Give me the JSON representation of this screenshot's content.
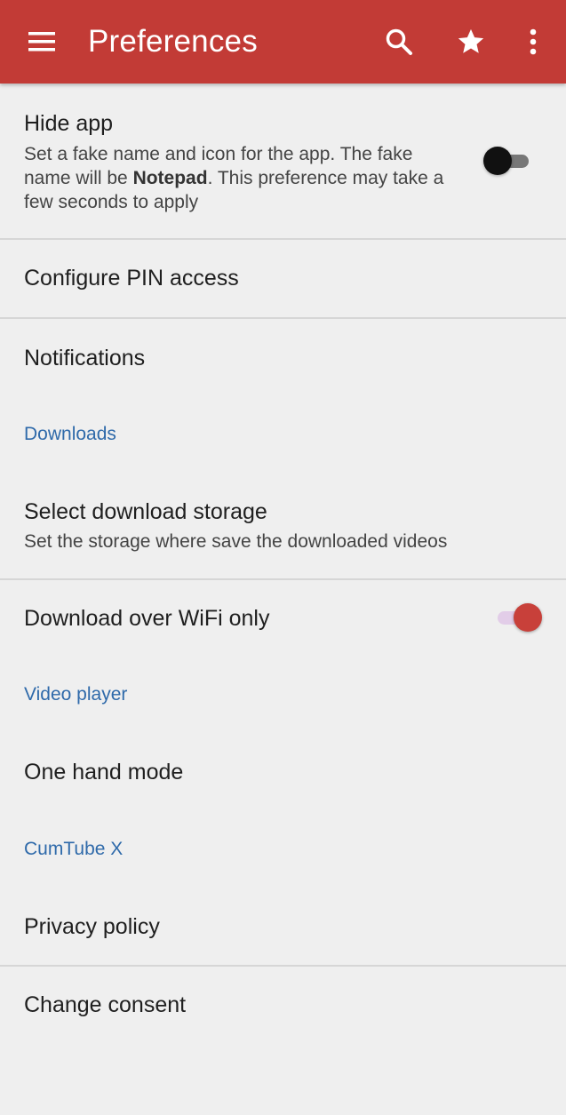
{
  "appbar": {
    "title": "Preferences",
    "menu_icon": "hamburger-menu-icon",
    "search_icon": "search-icon",
    "star_icon": "star-icon",
    "overflow_icon": "more-vert-icon",
    "color": "#c23b36"
  },
  "prefs": {
    "hide_app": {
      "title": "Hide app",
      "summary_pre": "Set a fake name and icon for the app. The fake name will be ",
      "summary_bold": "Notepad",
      "summary_post": ". This preference may take a few seconds to apply",
      "enabled": false
    },
    "configure_pin": {
      "title": "Configure PIN access"
    },
    "notifications": {
      "title": "Notifications"
    },
    "downloads_category": "Downloads",
    "download_storage": {
      "title": "Select download storage",
      "summary": "Set the storage where save the downloaded videos"
    },
    "wifi_only": {
      "title": "Download over WiFi only",
      "enabled": true
    },
    "video_player_category": "Video player",
    "one_hand_mode": {
      "title": "One hand mode"
    },
    "app_category": "CumTube X",
    "privacy_policy": {
      "title": "Privacy policy"
    },
    "change_consent": {
      "title": "Change consent"
    }
  },
  "colors": {
    "accent": "#c8403a",
    "category_text": "#2f6aaa",
    "switch_on_track": "#e2cde8",
    "switch_off_track": "#777777",
    "switch_off_thumb": "#111111"
  }
}
